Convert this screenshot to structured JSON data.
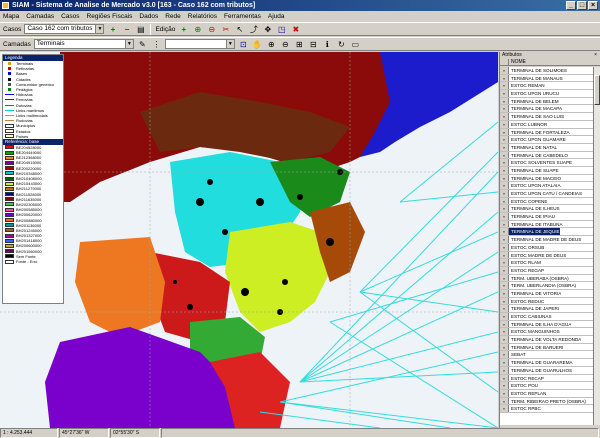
{
  "title": "SIAM - Sistema de Analise de Mercado v3.0 [163 - Caso 162 com tributos]",
  "menu": [
    "Mapa",
    "Camadas",
    "Casos",
    "Regiões Fiscais",
    "Dados",
    "Rede",
    "Relatórios",
    "Ferramentas",
    "Ajuda"
  ],
  "toolbar": {
    "casos_label": "Casos",
    "casos_value": "Caso 162 com tributos",
    "edicao_label": "Edição",
    "camadas_label": "Camadas",
    "camadas_value": "Terminais"
  },
  "legend": {
    "header1": "Legenda",
    "items": [
      {
        "label": "Terminais",
        "color": "#e0a000",
        "kind": "dot"
      },
      {
        "label": "Refinarias",
        "color": "#cc0000",
        "kind": "dot"
      },
      {
        "label": "Bases",
        "color": "#0000cc",
        "kind": "dot"
      },
      {
        "label": "Cidades",
        "color": "#000000",
        "kind": "dot"
      },
      {
        "label": "Consumidor genérico",
        "color": "#555555",
        "kind": "dot"
      },
      {
        "label": "Pedágios",
        "color": "#008000",
        "kind": "dot"
      },
      {
        "label": "Hidrovias",
        "color": "#0000ff",
        "kind": "line"
      },
      {
        "label": "Ferrovias",
        "color": "#333333",
        "kind": "line"
      },
      {
        "label": "Dutovias",
        "color": "#cc00cc",
        "kind": "line"
      },
      {
        "label": "Links marítimos",
        "color": "#00cccc",
        "kind": "line"
      },
      {
        "label": "Links multimodais",
        "color": "#999999",
        "kind": "line"
      },
      {
        "label": "Rodovias",
        "color": "#c08040",
        "kind": "line"
      },
      {
        "label": "Municípios",
        "color": "#ffffff",
        "kind": "box"
      },
      {
        "label": "Estados",
        "color": "#ffffff",
        "kind": "box"
      },
      {
        "label": "Países",
        "color": "#ffffc0",
        "kind": "box"
      }
    ],
    "header2": "Referência: base",
    "bases": [
      {
        "label": "BE204528000",
        "color": "#ff0000"
      },
      {
        "label": "BE204449000",
        "color": "#00aa00"
      },
      {
        "label": "BE212368000",
        "color": "#ff8800"
      },
      {
        "label": "BE204915000",
        "color": "#8800aa"
      },
      {
        "label": "BE200220000",
        "color": "#aa0000"
      },
      {
        "label": "BH210348000",
        "color": "#00cccc"
      },
      {
        "label": "BH210408000",
        "color": "#006600"
      },
      {
        "label": "BH210443000",
        "color": "#ccee44"
      },
      {
        "label": "BH211279000",
        "color": "#cc6600"
      },
      {
        "label": "BH211528000",
        "color": "#0000aa"
      },
      {
        "label": "BH211635000",
        "color": "#880000"
      },
      {
        "label": "BH202305000",
        "color": "#44cc44"
      },
      {
        "label": "BH200585000",
        "color": "#ff44aa"
      },
      {
        "label": "BH200620000",
        "color": "#6600cc"
      },
      {
        "label": "BH200880000",
        "color": "#ff6600"
      },
      {
        "label": "BH201136000",
        "color": "#009999"
      },
      {
        "label": "BH201245000",
        "color": "#996633"
      },
      {
        "label": "BH201327000",
        "color": "#aa00aa"
      },
      {
        "label": "BH201418000",
        "color": "#3366ff"
      },
      {
        "label": "BH200600000",
        "color": "#ccaa00"
      },
      {
        "label": "BH201560000",
        "color": "#660066"
      },
      {
        "label": "Sem Fonte",
        "color": "#000000"
      },
      {
        "label": "Fonte - Erro",
        "color": "#ffffff"
      }
    ]
  },
  "attributes": {
    "title": "Atributos",
    "column": "NOME",
    "selected_index": 21,
    "rows": [
      "TERMINAL DE SOLIMOES",
      "TERMINAL DE MANAUS",
      "ESTOC REMAN",
      "ESTOC UPGN URUCU",
      "TERMINAL DE BELEM",
      "TERMINAL DE MACAPA",
      "TERMINAL DE SAO LUIS",
      "ESTOC LUBNOR",
      "TERMINAL DE FORTALEZA",
      "ESTOC UPGN GUAMARE",
      "TERMINAL DE NATAL",
      "TERMINAL DE CABEDELO",
      "ESTOC SOLVENTES SUAPE",
      "TERMINAL DE SUAPE",
      "TERMINAL DE MACEIO",
      "ESTOC UPGN ATALAIA",
      "ESTOC UPGN CATU / CANDEIAS",
      "ESTOC COPENE",
      "TERMINAL DE ILHEUS",
      "TERMINAL DE IPIAU",
      "TERMINAL DE ITABUNA",
      "TERMINAL DE JEQUIE",
      "TERMINAL DE MADRE DE DEUS",
      "ESTOC ORSUB",
      "ESTOC MADRE DE DEUS",
      "ESTOC RLAM",
      "ESTOC REGAP",
      "TERM. UBERABA (OSBRA)",
      "TERM. UBERLANDIA (OSBRA)",
      "TERMINAL DE VITORIA",
      "ESTOC REDUC",
      "TERMINAL DE JAPERI",
      "ESTOC CABIUNAS",
      "TERMINAL DE ILHA D'AGUA",
      "ESTOC MANGUINHOS",
      "TERMINAL DE VOLTA REDONDA",
      "TERMINAL DE BARUERI",
      "SEBAT",
      "TERMINAL DE GUARAREMA",
      "TERMINAL DE GUARULHOS",
      "ESTOC RECAP",
      "ESTOC POU",
      "ESTOC REPLAN",
      "TERM. RIBEIRAO PRETO (OSBRA)",
      "ESTOC RPBC"
    ]
  },
  "status": {
    "scale": "1 : 4.253.444",
    "lon": "45°27'36\" W",
    "lat": "02°55'30\" S"
  }
}
